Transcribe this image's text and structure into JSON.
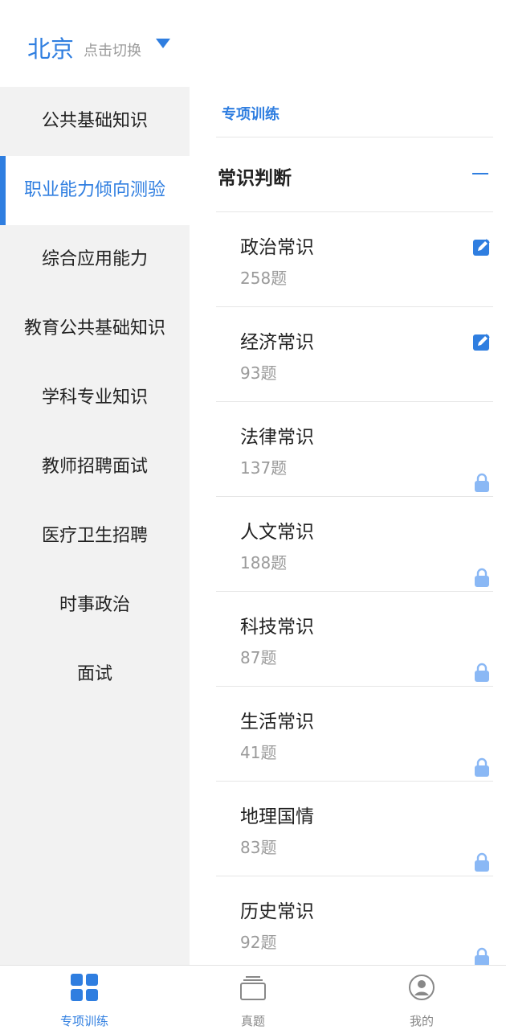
{
  "header": {
    "city": "北京",
    "switch_hint": "点击切换"
  },
  "sidebar": {
    "items": [
      {
        "label": "公共基础知识"
      },
      {
        "label": "职业能力倾向测验"
      },
      {
        "label": "综合应用能力"
      },
      {
        "label": "教育公共基础知识"
      },
      {
        "label": "学科专业知识"
      },
      {
        "label": "教师招聘面试"
      },
      {
        "label": "医疗卫生招聘"
      },
      {
        "label": "时事政治"
      },
      {
        "label": "面试"
      }
    ],
    "active_index": 1
  },
  "main": {
    "breadcrumb": "专项训练",
    "section": {
      "title": "常识判断"
    },
    "items": [
      {
        "name": "政治常识",
        "count": "258题",
        "icon": "edit-icon"
      },
      {
        "name": "经济常识",
        "count": "93题",
        "icon": "edit-icon"
      },
      {
        "name": "法律常识",
        "count": "137题",
        "icon": "lock-icon"
      },
      {
        "name": "人文常识",
        "count": "188题",
        "icon": "lock-icon"
      },
      {
        "name": "科技常识",
        "count": "87题",
        "icon": "lock-icon"
      },
      {
        "name": "生活常识",
        "count": "41题",
        "icon": "lock-icon"
      },
      {
        "name": "地理国情",
        "count": "83题",
        "icon": "lock-icon"
      },
      {
        "name": "历史常识",
        "count": "92题",
        "icon": "lock-icon"
      }
    ]
  },
  "bottom_nav": {
    "tabs": [
      {
        "label": "专项训练",
        "icon": "grid-icon"
      },
      {
        "label": "真题",
        "icon": "stack-icon"
      },
      {
        "label": "我的",
        "icon": "user-icon"
      }
    ],
    "active_index": 0
  },
  "colors": {
    "accent": "#2f7ee0",
    "lock": "#8ab8f5",
    "sidebar_bg": "#f2f2f2",
    "muted": "#9a9a9a"
  }
}
